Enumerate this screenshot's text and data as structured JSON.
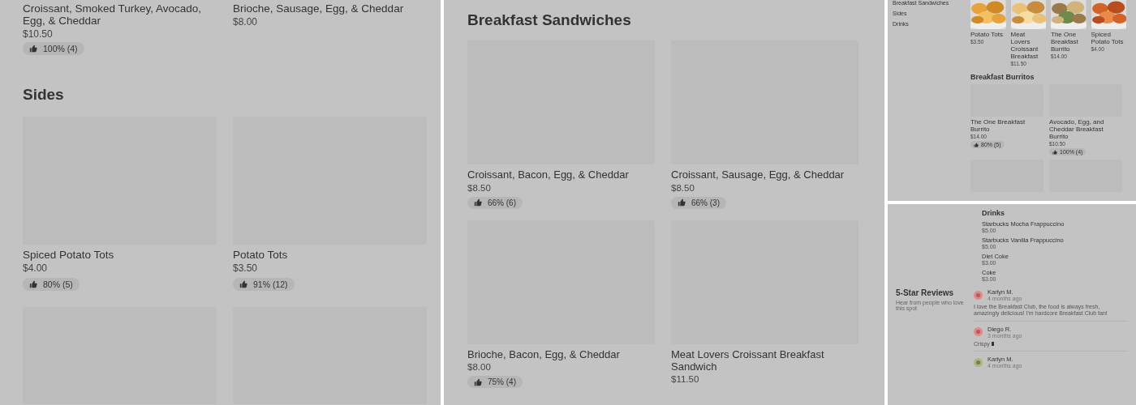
{
  "left_view": {
    "items_top": [
      {
        "name": "Croissant, Smoked Turkey, Avocado, Egg, & Cheddar",
        "price": "$10.50",
        "rating": "100% (4)"
      },
      {
        "name": "Brioche, Sausage,  Egg, & Cheddar",
        "price": "$8.00"
      }
    ],
    "section": {
      "title": "Sides",
      "items": [
        {
          "name": "Spiced Potato Tots",
          "price": "$4.00",
          "rating": "80% (5)"
        },
        {
          "name": "Potato Tots",
          "price": "$3.50",
          "rating": "91% (12)"
        }
      ]
    }
  },
  "middle_view": {
    "title": "Breakfast Sandwiches",
    "items": [
      {
        "name": "Croissant, Bacon, Egg, & Cheddar",
        "price": "$8.50",
        "rating": "66% (6)"
      },
      {
        "name": "Croissant, Sausage,  Egg, & Cheddar",
        "price": "$8.50",
        "rating": "66% (3)"
      },
      {
        "name": "Brioche, Bacon, Egg, & Cheddar",
        "price": "$8.00",
        "rating": "75% (4)"
      },
      {
        "name": "Meat Lovers Croissant Breakfast Sandwich",
        "price": "$11.50"
      }
    ]
  },
  "overview": {
    "sidebar": {
      "items": [
        "Breakfast Sandwiches",
        "Sides",
        "Drinks"
      ]
    },
    "popular": [
      {
        "name": "Potato Tots",
        "price": "$3.50"
      },
      {
        "name": "Meat Lovers Croissant Breakfast",
        "price": "$11.50"
      },
      {
        "name": "The One Breakfast Burrito",
        "price": "$14.00"
      },
      {
        "name": "Spiced Potato Tots",
        "price": "$4.00"
      }
    ],
    "section": {
      "title": "Breakfast Burritos",
      "items": [
        {
          "name": "The One Breakfast Burrito",
          "price": "$14.00",
          "rating": "80% (5)"
        },
        {
          "name": "Avocado, Egg, and Cheddar Breakfast Burrito",
          "price": "$10.50",
          "rating": "100% (4)"
        }
      ]
    }
  },
  "bottom_view": {
    "drinks": {
      "title": "Drinks",
      "items": [
        {
          "name": "Starbucks Mocha Frappuccino",
          "price": "$5.00"
        },
        {
          "name": "Starbucks Vanilla Frappuccino",
          "price": "$5.00"
        },
        {
          "name": "Diet Coke",
          "price": "$3.00"
        },
        {
          "name": "Coke",
          "price": "$3.00"
        }
      ]
    },
    "reviews": {
      "title": "5-Star Reviews",
      "subtitle": "Hear from people who love this spot",
      "items": [
        {
          "author": "Karlyn M.",
          "time": "4 months ago",
          "text": "I love the Breakfast Club, the food is always fresh, amazingly delicious! I'm hardcore Breakfast Club fan!",
          "color": "#e08a8a"
        },
        {
          "author": "Diego R.",
          "time": "3 months ago",
          "text": "Crispy",
          "color": "#e08a8a"
        },
        {
          "author": "Karlyn M.",
          "time": "4 months ago",
          "color": "#9bbf7e"
        }
      ]
    }
  }
}
